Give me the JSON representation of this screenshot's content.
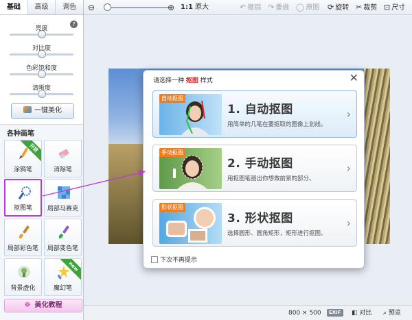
{
  "left_panel": {
    "tabs": [
      {
        "label": "基础",
        "active": true
      },
      {
        "label": "高级",
        "active": false
      },
      {
        "label": "调色",
        "active": false
      }
    ],
    "sliders": [
      {
        "label": "亮度",
        "value": 0.5
      },
      {
        "label": "对比度",
        "value": 0.5
      },
      {
        "label": "色彩饱和度",
        "value": 0.5
      },
      {
        "label": "清晰度",
        "value": 0.5
      }
    ],
    "one_key_button": "一键美化",
    "brushes_title": "各种画笔",
    "tools": [
      {
        "label": "涂鸦笔",
        "icon": "graffiti-pen-icon",
        "ribbon": "开放"
      },
      {
        "label": "消除笔",
        "icon": "eraser-pen-icon"
      },
      {
        "label": "抠图笔",
        "icon": "cutout-pen-icon",
        "selected": true
      },
      {
        "label": "局部马赛克",
        "icon": "mosaic-icon"
      },
      {
        "label": "局部彩色笔",
        "icon": "color-brush-icon"
      },
      {
        "label": "局部变色笔",
        "icon": "recolor-brush-icon"
      },
      {
        "label": "背景虚化",
        "icon": "blur-background-icon"
      },
      {
        "label": "魔幻笔",
        "icon": "magic-pen-icon",
        "ribbon": "new"
      }
    ],
    "tutorial_button": "美化教程"
  },
  "toolbar": {
    "zoom_ratio": "1:1",
    "original_size": "原大",
    "undo": "撤销",
    "redo": "重做",
    "original_image": "原图",
    "rotate": "旋转",
    "crop": "裁剪",
    "resize": "尺寸",
    "zoom_level": 0.05
  },
  "dialog": {
    "title_prefix": "请选择一种",
    "title_highlight": "抠图",
    "title_suffix": "样式",
    "options": [
      {
        "badge": "自动抠图",
        "title": "1. 自动抠图",
        "desc": "用简单的几笔在要抠取的图像上划线。"
      },
      {
        "badge": "手动抠图",
        "title": "2. 手动抠图",
        "desc": "用抠图笔圈出你想做前景的部分。"
      },
      {
        "badge": "形状抠图",
        "title": "3. 形状抠图",
        "desc": "选择圆形、圆角矩形，矩形进行抠图。"
      }
    ],
    "dont_show": "下次不再提示"
  },
  "status_bar": {
    "size": "800 × 500",
    "exif": "EXIF",
    "compare": "对比",
    "preview": "预览"
  },
  "colors": {
    "accent": "#b83bd6",
    "highlight_red": "#d2282f",
    "badge_orange": "#f07d1c"
  }
}
